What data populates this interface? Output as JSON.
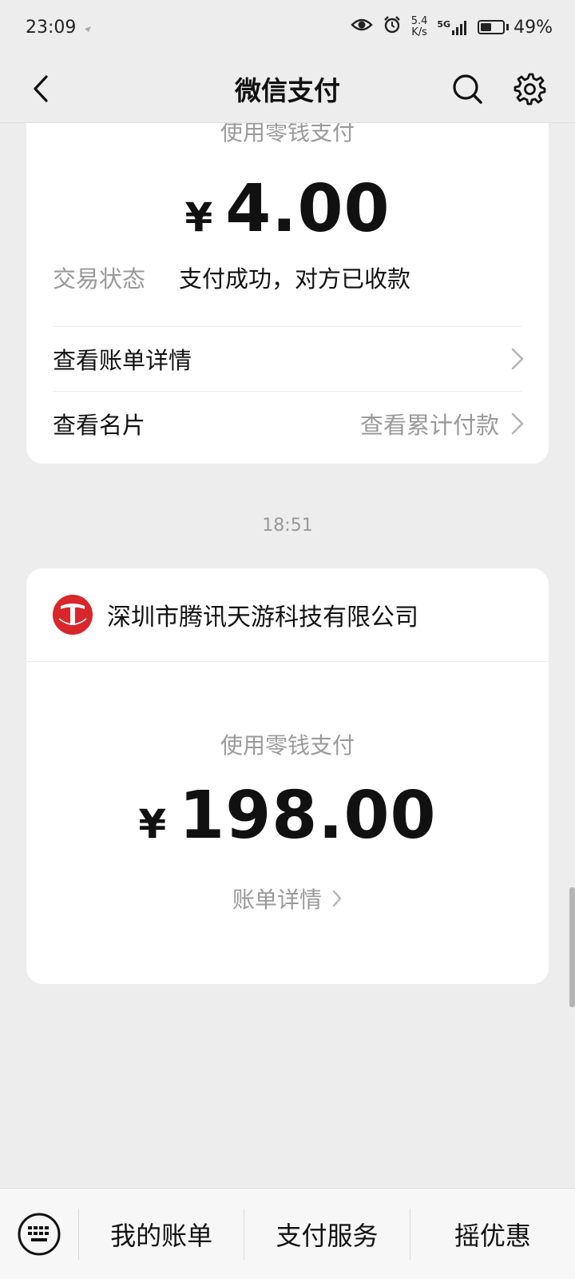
{
  "status_bar": {
    "time": "23:09",
    "net_speed_value": "5.4",
    "net_speed_unit": "K/s",
    "network_type": "5G",
    "battery_percent": "49%",
    "battery_level": 0.49
  },
  "nav": {
    "title": "微信支付"
  },
  "card1": {
    "payment_method": "使用零钱支付",
    "currency": "¥",
    "amount": "4.00",
    "status_label": "交易状态",
    "status_value": "支付成功，对方已收款",
    "bill_details_label": "查看账单详情",
    "business_card_label": "查看名片",
    "cumulative_label": "查看累计付款"
  },
  "timestamp": "18:51",
  "card2": {
    "merchant_name": "深圳市腾讯天游科技有限公司",
    "payment_method": "使用零钱支付",
    "currency": "¥",
    "amount": "198.00",
    "bill_details_label": "账单详情"
  },
  "bottom_bar": {
    "tab1": "我的账单",
    "tab2": "支付服务",
    "tab3": "摇优惠"
  },
  "colors": {
    "background": "#ededed",
    "card": "#ffffff",
    "secondary_text": "#999999",
    "merchant_logo": "#d8262b"
  }
}
